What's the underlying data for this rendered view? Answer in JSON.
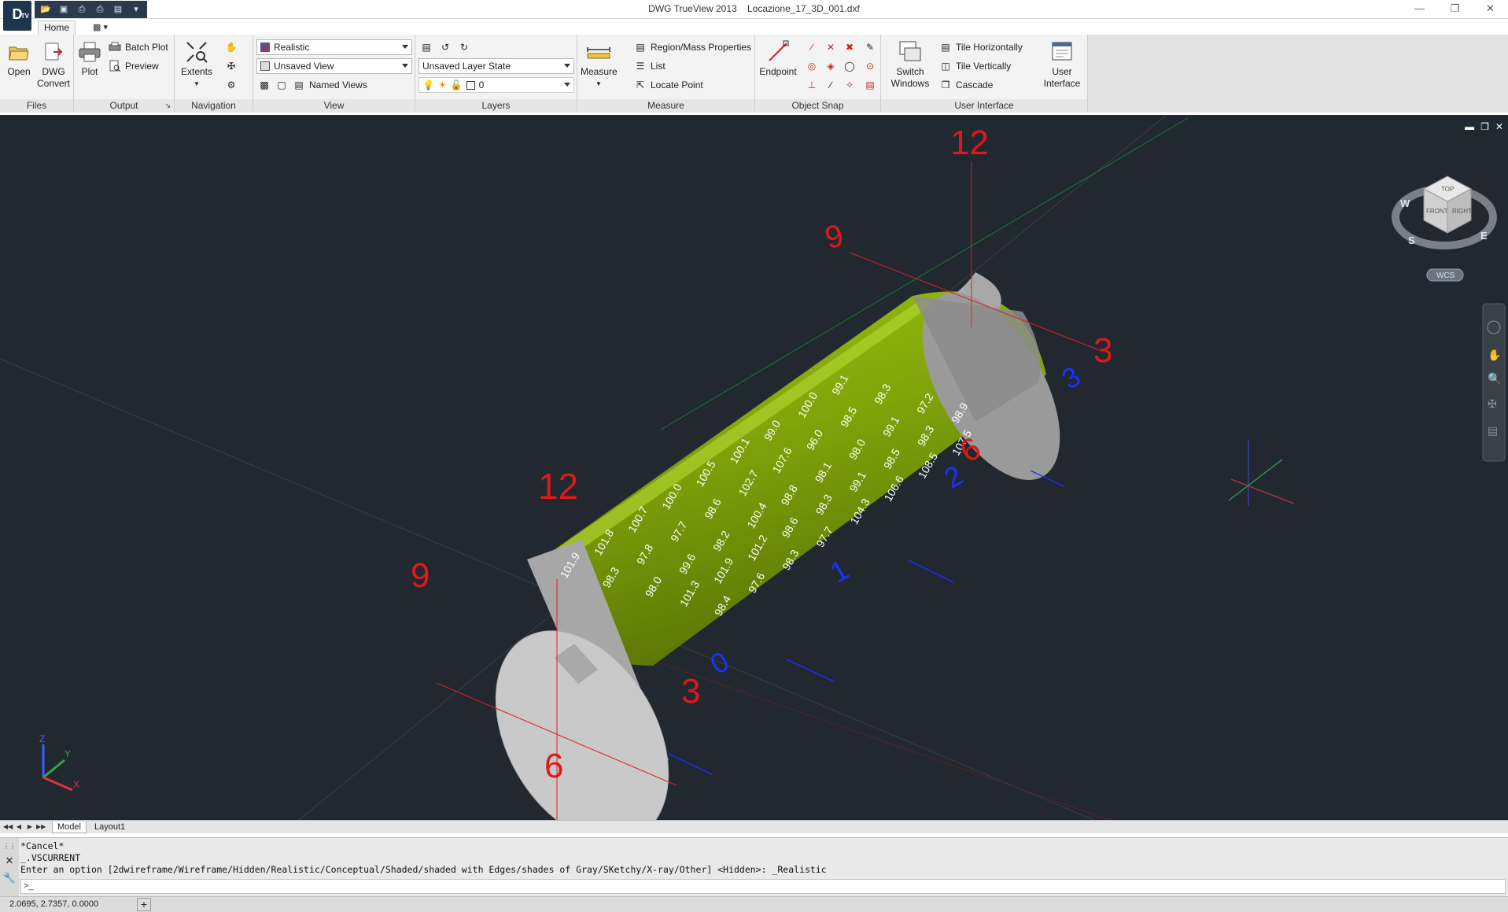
{
  "app": {
    "title": "DWG TrueView 2013",
    "filename": "Locazione_17_3D_001.dxf",
    "badge": "TV"
  },
  "ribbon_tabs": {
    "home": "Home"
  },
  "panels": {
    "files": {
      "title": "Files",
      "open": "Open",
      "dwg_convert_line1": "DWG",
      "dwg_convert_line2": "Convert"
    },
    "output": {
      "title": "Output",
      "plot": "Plot",
      "batch_plot": "Batch Plot",
      "preview": "Preview"
    },
    "navigation": {
      "title": "Navigation",
      "extents": "Extents"
    },
    "view": {
      "title": "View",
      "visual_style": "Realistic",
      "named_view": "Unsaved View",
      "named_views": "Named Views"
    },
    "layers": {
      "title": "Layers",
      "layer_state": "Unsaved Layer State",
      "current_layer": "0"
    },
    "measure": {
      "title": "Measure",
      "measure": "Measure",
      "region_mass": "Region/Mass Properties",
      "list": "List",
      "locate_point": "Locate Point"
    },
    "object_snap": {
      "title": "Object Snap",
      "endpoint": "Endpoint"
    },
    "user_interface": {
      "title": "User Interface",
      "switch_windows_line1": "Switch",
      "switch_windows_line2": "Windows",
      "tile_horizontally": "Tile Horizontally",
      "tile_vertically": "Tile Vertically",
      "cascade": "Cascade",
      "user_interface_line1": "User",
      "user_interface_line2": "Interface"
    }
  },
  "viewport": {
    "viewcube": {
      "top": "TOP",
      "front": "FRONT",
      "right": "RIGHT",
      "compass_w": "W",
      "compass_s": "S",
      "compass_e": "E",
      "wcs": "WCS"
    },
    "clock_labels_red": [
      "12",
      "3",
      "6",
      "9",
      "12",
      "3",
      "6",
      "9"
    ],
    "clock_labels_blue": [
      "0",
      "1",
      "2",
      "3"
    ],
    "ring_values": [
      "101.9",
      "101.8",
      "100.7",
      "100.0",
      "100.5",
      "100.1",
      "99.0",
      "100.0",
      "99.1",
      "98.3",
      "97.8",
      "97.7",
      "98.6",
      "102.7",
      "107.6",
      "96.0",
      "98.5",
      "98.3",
      "98.0",
      "99.6",
      "98.2",
      "100.4",
      "98.8",
      "98.1",
      "98.0",
      "99.1",
      "97.2",
      "101.3",
      "101.9",
      "101.2",
      "98.6",
      "98.3",
      "99.1",
      "98.5",
      "98.3",
      "98.9",
      "98.4",
      "97.6",
      "98.3",
      "97.7",
      "104.3",
      "106.6",
      "108.5",
      "107.5"
    ],
    "axis_labels": {
      "x": "X",
      "y": "Y",
      "z": "Z"
    }
  },
  "layout_tabs": {
    "model": "Model",
    "layout1": "Layout1"
  },
  "command": {
    "history": [
      "*Cancel*",
      "_.VSCURRENT",
      "Enter an option [2dwireframe/Wireframe/Hidden/Realistic/Conceptual/Shaded/shaded with Edges/shades of Gray/SKetchy/X-ray/Other] <Hidden>: _Realistic"
    ],
    "prompt": ">_"
  },
  "status": {
    "coordinates": "2.0695, 2.7357, 0.0000"
  }
}
